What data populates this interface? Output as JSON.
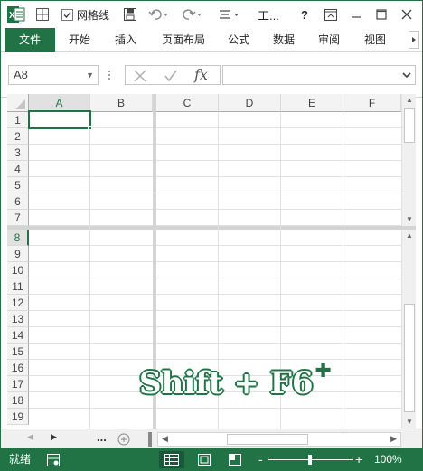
{
  "titlebar": {
    "gridlines_label": "网格线",
    "title": "工...",
    "help": "?",
    "excel_logo": "X"
  },
  "ribbon": {
    "tabs": [
      {
        "label": "文件",
        "active": true
      },
      {
        "label": "开始",
        "active": false
      },
      {
        "label": "插入",
        "active": false
      },
      {
        "label": "页面布局",
        "active": false
      },
      {
        "label": "公式",
        "active": false
      },
      {
        "label": "数据",
        "active": false
      },
      {
        "label": "审阅",
        "active": false
      },
      {
        "label": "视图",
        "active": false
      }
    ]
  },
  "formula_bar": {
    "name_box": "A8",
    "fx": "fx",
    "value": ""
  },
  "grid": {
    "columns": [
      "A",
      "B",
      "C",
      "D",
      "E",
      "F"
    ],
    "top_rows": [
      "1",
      "2",
      "3",
      "4",
      "5",
      "6",
      "7"
    ],
    "bottom_rows": [
      "8",
      "9",
      "10",
      "11",
      "12",
      "13",
      "14",
      "15",
      "16",
      "17",
      "18",
      "19"
    ],
    "selected_cell": "A8"
  },
  "sheet_bar": {
    "ellipsis": "..."
  },
  "status_bar": {
    "ready": "就绪",
    "zoom": "100%",
    "zoom_minus": "-",
    "zoom_plus": "+"
  },
  "overlay": {
    "shortcut": "Shift + F6"
  },
  "colors": {
    "accent": "#217346",
    "grid_line": "#e1e1e1",
    "header_bg": "#f3f3f3"
  }
}
